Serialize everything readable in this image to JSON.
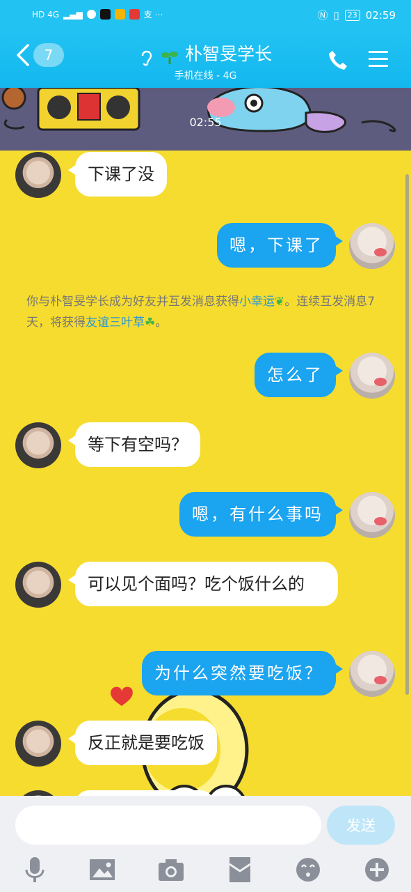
{
  "status_bar": {
    "network": "HD 4G",
    "time": "02:59",
    "battery": "23"
  },
  "header": {
    "back_badge": "7",
    "contact_name": "朴智旻学长",
    "contact_status": "手机在线 - 4G"
  },
  "chat": {
    "banner_time": "02:55",
    "messages": [
      {
        "side": "in",
        "text": "下课了没"
      },
      {
        "side": "out",
        "text": "嗯，下课了"
      },
      {
        "side": "out",
        "text": "怎么了"
      },
      {
        "side": "in",
        "text": "等下有空吗？"
      },
      {
        "side": "out",
        "text": "嗯，有什么事吗"
      },
      {
        "side": "in",
        "text": "可以见个面吗？吃个饭什么的"
      },
      {
        "side": "out",
        "text": "为什么突然要吃饭？"
      },
      {
        "side": "in",
        "text": "反正就是要吃饭"
      }
    ],
    "system_notice": {
      "part1": "你与朴智旻学长成为好友并互发消息获得",
      "link1": "小幸运",
      "part2": "。连续互发消息7天，将获得",
      "link2": "友谊三叶草",
      "part3": "。"
    }
  },
  "input": {
    "value": "",
    "send_label": "发送"
  },
  "toolbar": {
    "icons": [
      "microphone-icon",
      "image-icon",
      "camera-icon",
      "red-packet-icon",
      "emoji-icon",
      "plus-icon"
    ]
  },
  "colors": {
    "header": "#22c2f2",
    "chat_bg": "#f6dc2e",
    "bubble_out": "#1ba4f0",
    "link": "#2b96d8"
  }
}
